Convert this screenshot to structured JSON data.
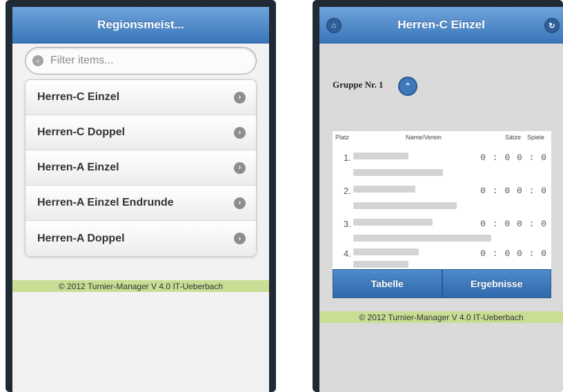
{
  "left": {
    "header_title": "Regionsmeist...",
    "search_placeholder": "Filter items...",
    "items": [
      {
        "label": "Herren-C Einzel"
      },
      {
        "label": "Herren-C Doppel"
      },
      {
        "label": "Herren-A Einzel"
      },
      {
        "label": "Herren-A Einzel Endrunde"
      },
      {
        "label": "Herren-A Doppel"
      }
    ],
    "footer": "© 2012 Turnier-Manager V 4.0 IT-Ueberbach"
  },
  "right": {
    "header_title": "Herren-C Einzel",
    "group_label": "Gruppe Nr. 1",
    "columns": {
      "platz": "Platz",
      "name": "Name/Verein",
      "saetze": "Sätze",
      "spiele": "Spiele"
    },
    "rows": [
      {
        "place": "1.",
        "score": "0 : 0 0 : 0"
      },
      {
        "place": "2.",
        "score": "0 : 0 0 : 0"
      },
      {
        "place": "3.",
        "score": "0 : 0 0 : 0"
      },
      {
        "place": "4.",
        "score": "0 : 0 0 : 0"
      }
    ],
    "tabs": {
      "tabelle": "Tabelle",
      "ergebnisse": "Ergebnisse"
    },
    "footer": "© 2012 Turnier-Manager V 4.0 IT-Ueberbach"
  },
  "icons": {
    "home": "home-icon",
    "refresh": "refresh-icon",
    "search": "search-icon",
    "chevron_right": "chevron-right-icon",
    "chevron_up": "chevron-up-icon"
  },
  "colors": {
    "header_blue": "#3a76b9",
    "footer_green": "#c9dd94"
  }
}
